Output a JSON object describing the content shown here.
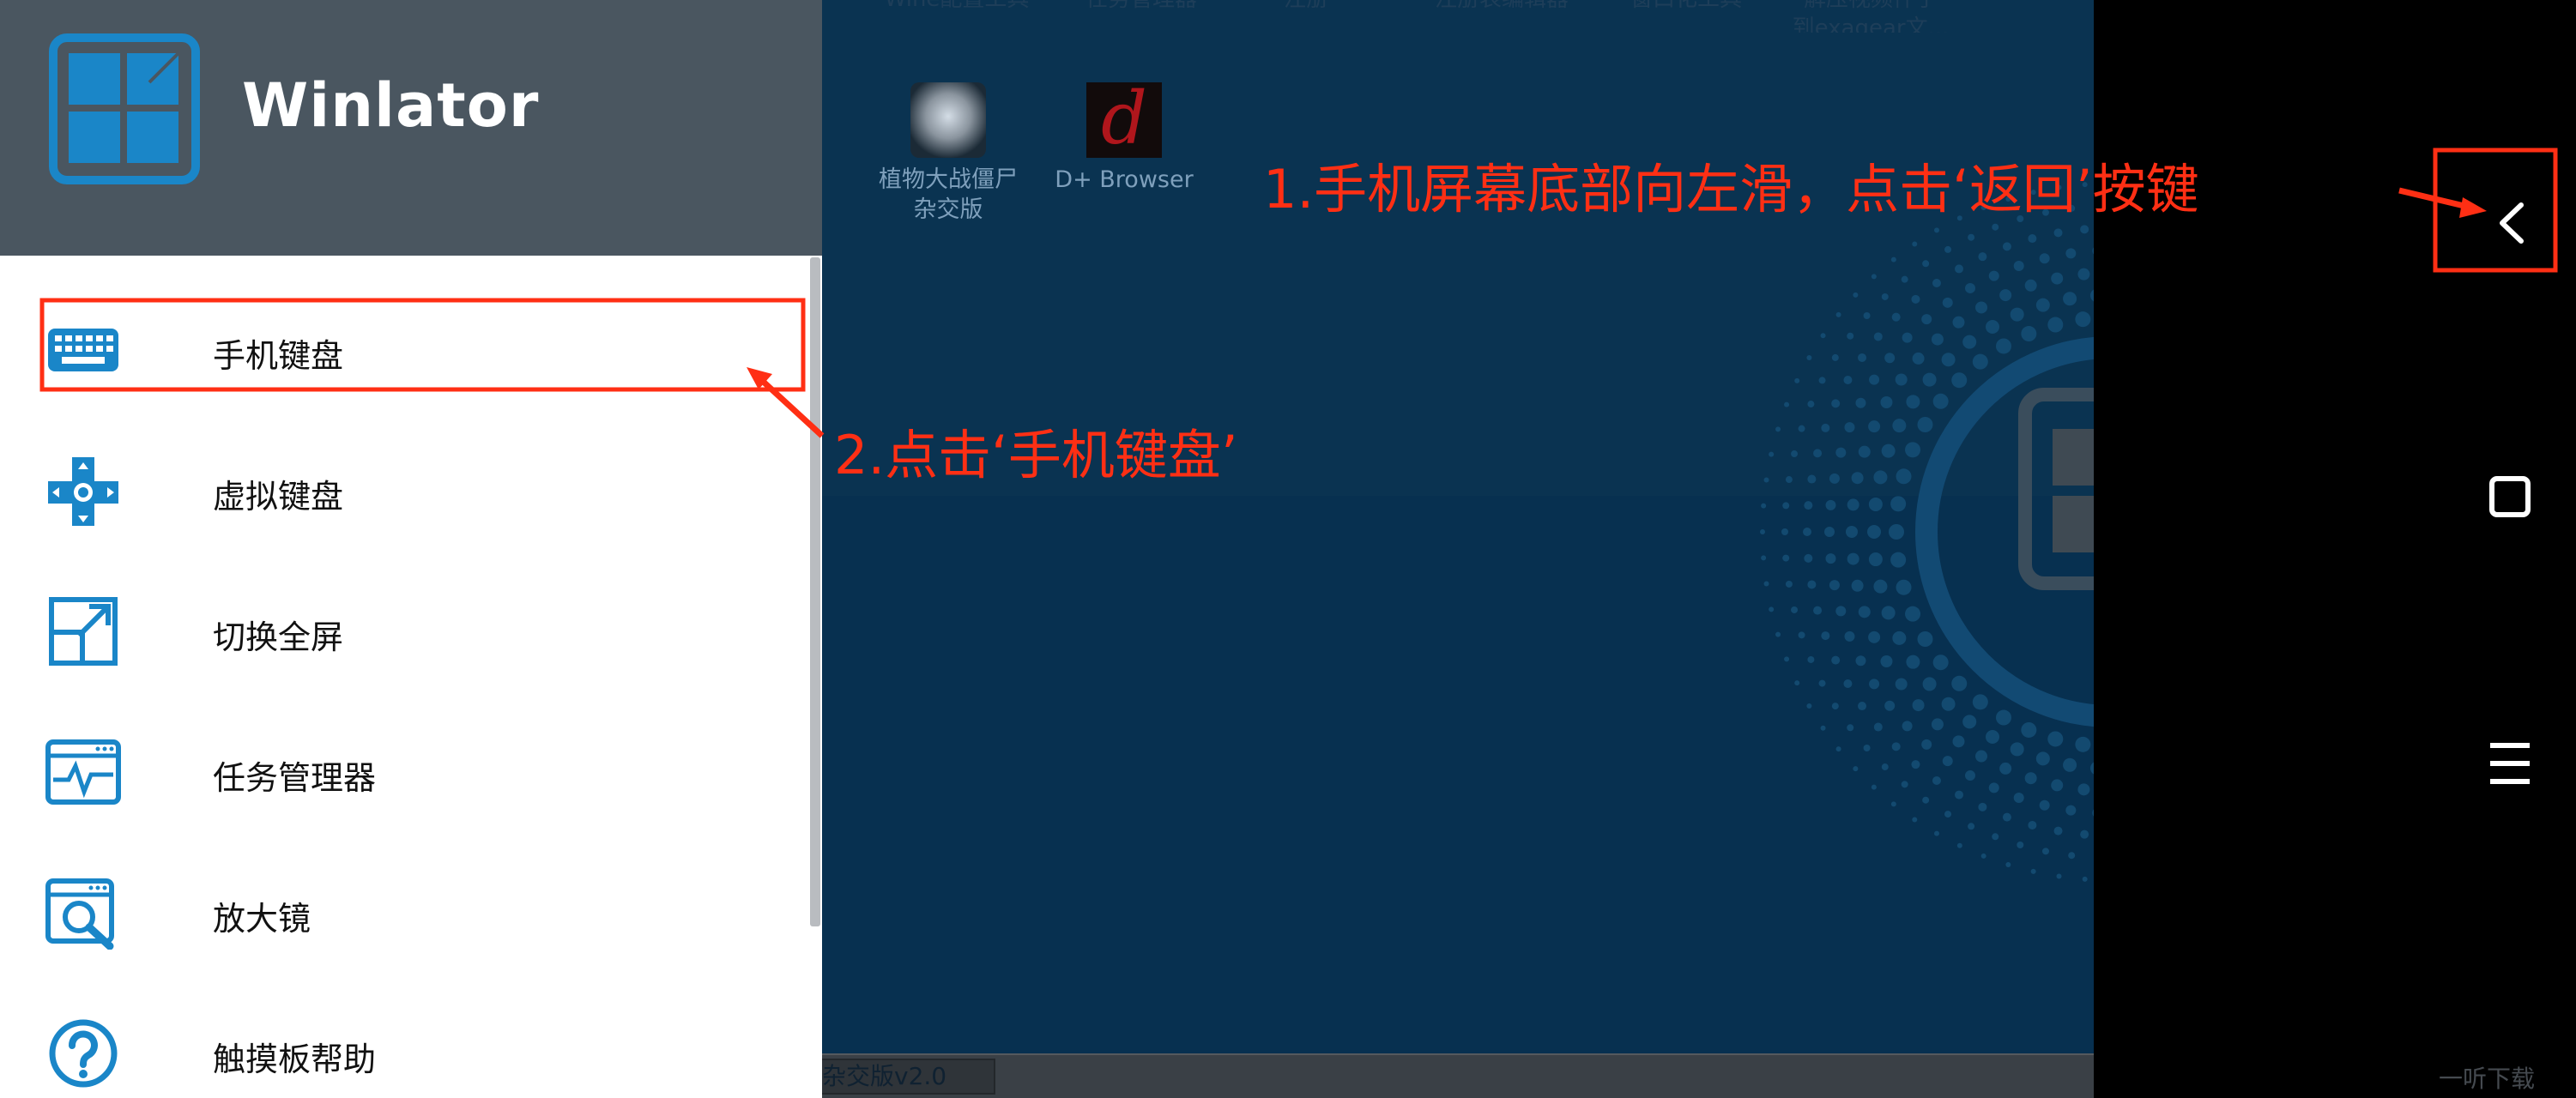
{
  "app": {
    "title": "Winlator"
  },
  "menu": {
    "items": [
      {
        "label": "手机键盘",
        "icon": "keyboard-icon"
      },
      {
        "label": "虚拟键盘",
        "icon": "gamepad-dpad-icon"
      },
      {
        "label": "切换全屏",
        "icon": "fullscreen-icon"
      },
      {
        "label": "任务管理器",
        "icon": "task-manager-icon"
      },
      {
        "label": "放大镜",
        "icon": "magnifier-icon"
      },
      {
        "label": "触摸板帮助",
        "icon": "help-icon"
      }
    ]
  },
  "desktop": {
    "top_labels": [
      "Wine配置工具",
      "任务管理器",
      "注册",
      "注册表编辑器",
      "窗口化工具",
      "解压视频件了\n到exagear文..."
    ],
    "icons": [
      {
        "label": "植物大战僵尸\n杂交版",
        "icon": "pvz-game-icon"
      },
      {
        "label": "D+ Browser",
        "icon": "d-browser-icon"
      }
    ],
    "taskbar_item": "杂交版v2.0"
  },
  "annotations": {
    "step1": "1.手机屏幕底部向左滑，点击‘返回’按键",
    "step2": "2.点击‘手机键盘’"
  },
  "watermark": "一听下载",
  "colors": {
    "drawer_header": "#4a5660",
    "accent_icon": "#1a86c8",
    "annotation": "#ff2f14",
    "desktop_bg": "#0a3351"
  }
}
